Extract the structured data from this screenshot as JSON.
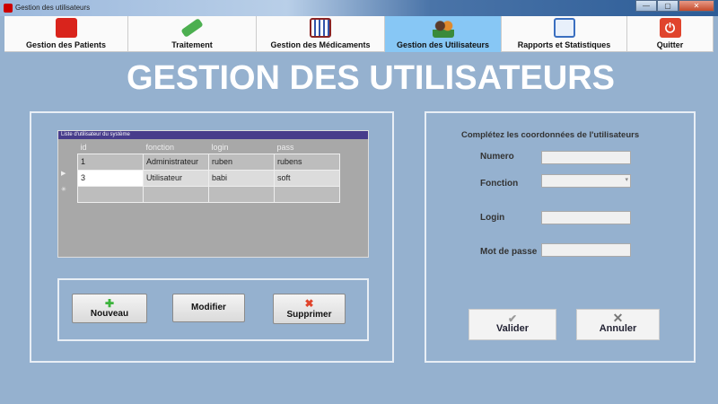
{
  "window": {
    "title": "Gestion des utilisateurs",
    "buttons": [
      "—",
      "▢",
      "✕"
    ]
  },
  "nav": [
    {
      "label": "Gestion des Patients",
      "icon": "patient-icon",
      "color": "#d9241c"
    },
    {
      "label": "Traitement",
      "icon": "syringe-icon",
      "color": "#4caf50"
    },
    {
      "label": "Gestion des Médicaments",
      "icon": "test-tubes-icon",
      "color": "#8b2323"
    },
    {
      "label": "Gestion des Utilisateurs",
      "icon": "users-icon",
      "color": "#e08a2c",
      "active": true
    },
    {
      "label": "Rapports et Statistiques",
      "icon": "report-icon",
      "color": "#3a6fc0"
    },
    {
      "label": "Quitter",
      "icon": "power-icon",
      "color": "#e0442c"
    }
  ],
  "page_title": "GESTION DES UTILISATEURS",
  "grid": {
    "caption": "Liste d'utilisateur du système",
    "columns": [
      "id",
      "fonction",
      "login",
      "pass"
    ],
    "rows": [
      [
        "1",
        "Administrateur",
        "ruben",
        "rubens"
      ],
      [
        "3",
        "Utilisateur",
        "babi",
        "soft"
      ]
    ]
  },
  "actions": {
    "new": "Nouveau",
    "edit": "Modifier",
    "delete": "Supprimer"
  },
  "form": {
    "heading": "Complétez les coordonnées de l'utilisateurs",
    "numero": "Numero",
    "fonction": "Fonction",
    "login": "Login",
    "password": "Mot de passe",
    "validate": "Valider",
    "cancel": "Annuler"
  }
}
